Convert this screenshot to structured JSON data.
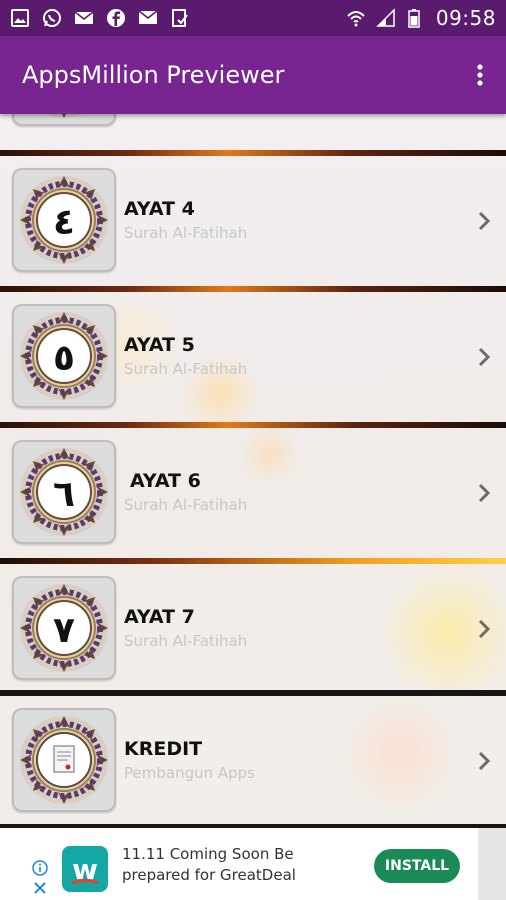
{
  "status_bar": {
    "time": "09:58",
    "left_icons": [
      "gallery-icon",
      "whatsapp-icon",
      "email-icon",
      "facebook-icon",
      "message-icon",
      "download-icon"
    ],
    "right_icons": [
      "wifi-icon",
      "signal-icon",
      "battery-icon"
    ]
  },
  "app_bar": {
    "title": "AppsMillion Previewer"
  },
  "list": {
    "items": [
      {
        "title": "AYAT 4",
        "subtitle": "Surah Al-Fatihah",
        "numeral": "٤"
      },
      {
        "title": "AYAT 5",
        "subtitle": "Surah Al-Fatihah",
        "numeral": "٥"
      },
      {
        "title": "AYAT 6",
        "subtitle": "Surah Al-Fatihah",
        "numeral": "٦"
      },
      {
        "title": "AYAT 7",
        "subtitle": "Surah Al-Fatihah",
        "numeral": "٧"
      },
      {
        "title": "KREDIT",
        "subtitle": "Pembangun Apps",
        "numeral": ""
      }
    ]
  },
  "ad": {
    "text": "11.11 Coming Soon Be prepared for GreatDeal",
    "install_label": "INSTALL",
    "logo_letter": "w"
  },
  "colors": {
    "status_bar": "#5a1a6e",
    "app_bar": "#782491",
    "install_button": "#1a8a57",
    "ad_logo": "#14a7a4"
  }
}
